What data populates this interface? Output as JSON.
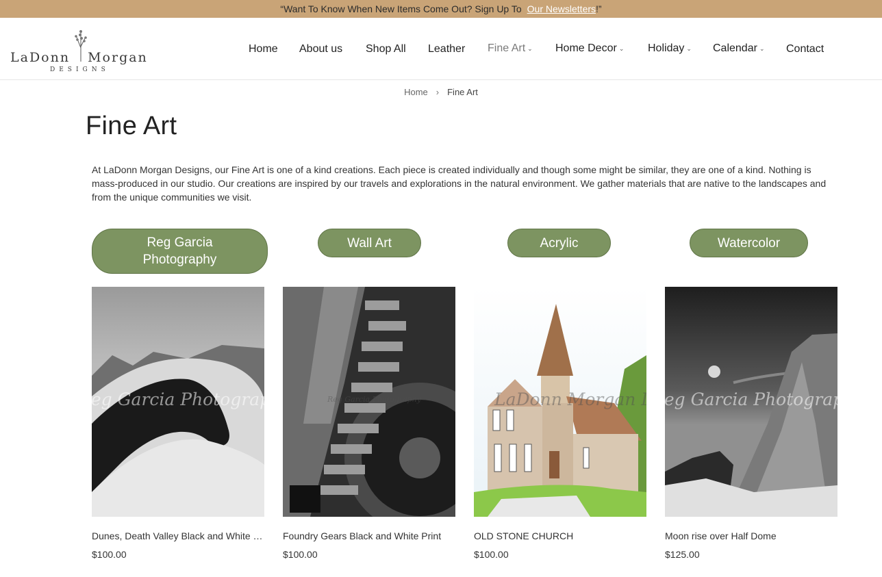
{
  "announcement": {
    "text": "“Want To Know When New Items Come Out? Sign Up To",
    "link": "Our Newsletters",
    "suffix": " !”"
  },
  "logo": {
    "name_left": "LaDonn",
    "name_right": "Morgan",
    "sub": "DESIGNS"
  },
  "nav": [
    {
      "label": "Home"
    },
    {
      "label": "About us"
    },
    {
      "label": "Shop All"
    },
    {
      "label": "Leather"
    },
    {
      "label": "Fine Art",
      "dropdown": true,
      "active": true
    },
    {
      "label": "Home Decor",
      "dropdown": true
    },
    {
      "label": "Holiday",
      "dropdown": true
    },
    {
      "label": "Calendar",
      "dropdown": true
    },
    {
      "label": "Contact"
    }
  ],
  "breadcrumb": {
    "home": "Home",
    "separator": "›",
    "current": "Fine Art"
  },
  "page_title": "Fine Art",
  "intro": "At LaDonn Morgan Designs, our Fine Art is one of a kind creations. Each piece is created individually and though some might be similar, they are one of a kind. Nothing is mass-produced in our studio. Our creations are inspired by our travels and explorations in the natural environment. We gather materials that are native to the landscapes and from the unique communities we visit.",
  "categories": [
    {
      "label": "Reg Garcia Photography"
    },
    {
      "label": "Wall Art"
    },
    {
      "label": "Acrylic"
    },
    {
      "label": "Watercolor"
    }
  ],
  "products": [
    {
      "title": "Dunes, Death Valley Black and White Print",
      "price": "$100.00",
      "watermark": "Reg Garcia Photography"
    },
    {
      "title": "Foundry Gears Black and White Print",
      "price": "$100.00",
      "watermark": "Reg Garcia Photography"
    },
    {
      "title": "OLD STONE CHURCH",
      "price": "$100.00",
      "watermark": "LaDonn Morgan Designs"
    },
    {
      "title": "Moon rise over Half Dome",
      "price": "$125.00",
      "watermark": "Reg Garcia Photography"
    }
  ],
  "colors": {
    "announcement_bg": "#c9a477",
    "pill_bg": "#7d9461",
    "text": "#222222"
  }
}
